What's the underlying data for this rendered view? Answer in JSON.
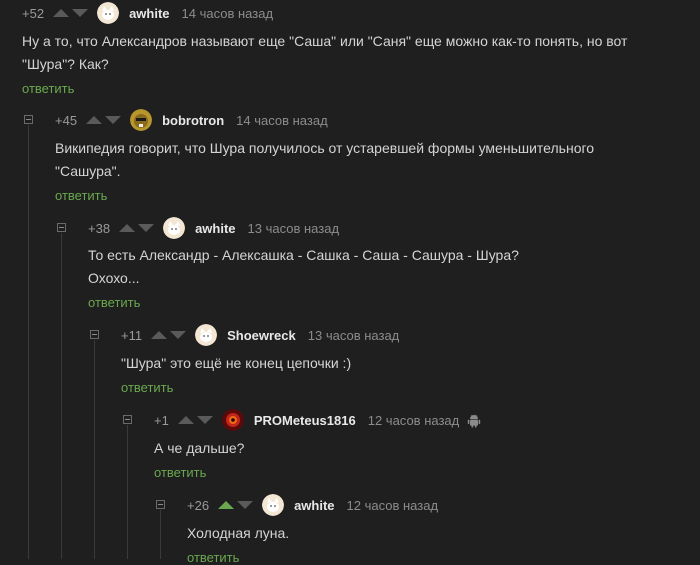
{
  "comments": [
    {
      "rating": "+52",
      "username": "awhite",
      "time": "14 часов назад",
      "lines": [
        "Ну а то, что Александров называют еще \"Саша\" или \"Саня\" еще можно как-то понять, но вот",
        "\"Шура\"? Как?"
      ],
      "reply": "ответить",
      "avatar": "cat-avatar"
    },
    {
      "rating": "+45",
      "username": "bobrotron",
      "time": "14 часов назад",
      "lines": [
        "Википедия говорит, что Шура получилось от устаревшей формы уменьшительного",
        "\"Сашура\"."
      ],
      "reply": "ответить",
      "avatar": "beaver-avatar"
    },
    {
      "rating": "+38",
      "username": "awhite",
      "time": "13 часов назад",
      "lines": [
        "То есть Александр - Алексашка - Сашка - Саша - Сашура - Шура?",
        "Охохо..."
      ],
      "reply": "ответить",
      "avatar": "cat-avatar"
    },
    {
      "rating": "+11",
      "username": "Shoewreck",
      "time": "13 часов назад",
      "lines": [
        "\"Шура\" это ещё не конец цепочки :)"
      ],
      "reply": "ответить",
      "avatar": "cat-avatar"
    },
    {
      "rating": "+1",
      "username": "PROMeteus1816",
      "time": "12 часов назад",
      "lines": [
        "А че дальше?"
      ],
      "reply": "ответить",
      "avatar": "fire-avatar",
      "device_icon": "android-icon"
    },
    {
      "rating": "+26",
      "username": "awhite",
      "time": "12 часов назад",
      "lines": [
        "Холодная луна."
      ],
      "reply": "ответить",
      "avatar": "cat-avatar",
      "upvoted": true
    }
  ],
  "colors": {
    "background": "#1f1f1f",
    "reply_link": "#6aa84f",
    "upvote_active": "#6aa84f"
  }
}
